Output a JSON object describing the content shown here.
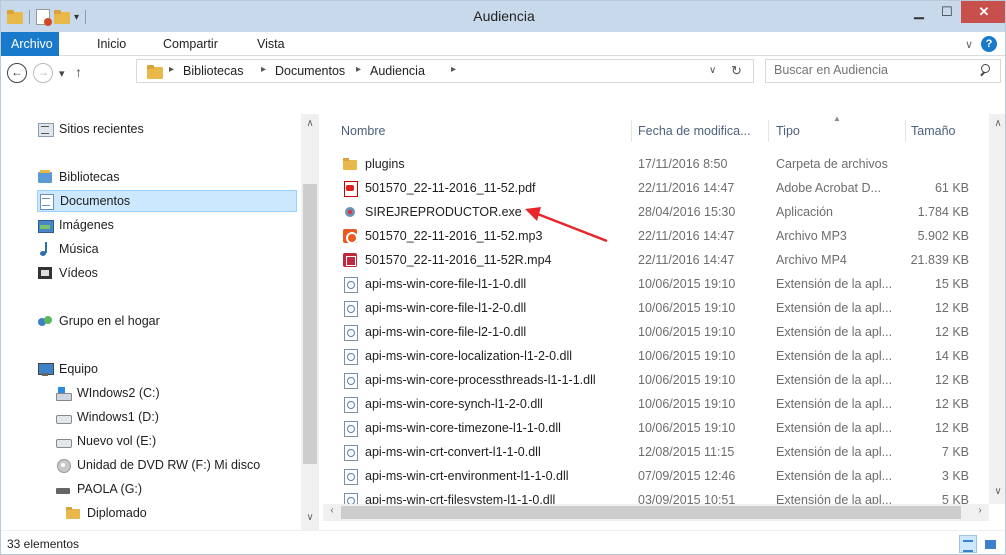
{
  "window": {
    "title": "Audiencia"
  },
  "ribbon": {
    "tabs": [
      {
        "label": "Archivo"
      },
      {
        "label": "Inicio"
      },
      {
        "label": "Compartir"
      },
      {
        "label": "Vista"
      }
    ]
  },
  "address": {
    "crumbs": [
      "Bibliotecas",
      "Documentos",
      "Audiencia"
    ]
  },
  "search": {
    "placeholder": "Buscar en Audiencia"
  },
  "nav": {
    "items": [
      {
        "label": "Sitios recientes",
        "icon": "recent-places-icon"
      },
      {
        "label": "Bibliotecas",
        "icon": "libraries-icon"
      },
      {
        "label": "Documentos",
        "icon": "documents-icon",
        "selected": true
      },
      {
        "label": "Imágenes",
        "icon": "pictures-icon"
      },
      {
        "label": "Música",
        "icon": "music-icon"
      },
      {
        "label": "Vídeos",
        "icon": "videos-icon"
      },
      {
        "label": "Grupo en el hogar",
        "icon": "homegroup-icon"
      },
      {
        "label": "Equipo",
        "icon": "computer-icon"
      },
      {
        "label": "WIndows2 (C:)",
        "icon": "windows-drive-icon"
      },
      {
        "label": "Windows1 (D:)",
        "icon": "drive-icon"
      },
      {
        "label": "Nuevo vol (E:)",
        "icon": "drive-icon"
      },
      {
        "label": "Unidad de DVD RW (F:) Mi disco",
        "icon": "dvd-drive-icon"
      },
      {
        "label": "PAOLA (G:)",
        "icon": "usb-drive-icon"
      },
      {
        "label": "Diplomado",
        "icon": "folder-icon"
      }
    ]
  },
  "columns": {
    "name": "Nombre",
    "date": "Fecha de modifica...",
    "type": "Tipo",
    "size": "Tamaño"
  },
  "files": [
    {
      "name": "plugins",
      "date": "17/11/2016 8:50",
      "type": "Carpeta de archivos",
      "size": "",
      "icon": "folder-icon"
    },
    {
      "name": "501570_22-11-2016_11-52.pdf",
      "date": "22/11/2016 14:47",
      "type": "Adobe Acrobat D...",
      "size": "61 KB",
      "icon": "pdf-icon"
    },
    {
      "name": "SIREJREPRODUCTOR.exe",
      "date": "28/04/2016 15:30",
      "type": "Aplicación",
      "size": "1.784 KB",
      "icon": "exe-icon"
    },
    {
      "name": "501570_22-11-2016_11-52.mp3",
      "date": "22/11/2016 14:47",
      "type": "Archivo MP3",
      "size": "5.902 KB",
      "icon": "mp3-icon"
    },
    {
      "name": "501570_22-11-2016_11-52R.mp4",
      "date": "22/11/2016 14:47",
      "type": "Archivo MP4",
      "size": "21.839 KB",
      "icon": "mp4-icon"
    },
    {
      "name": "api-ms-win-core-file-l1-1-0.dll",
      "date": "10/06/2015 19:10",
      "type": "Extensión de la apl...",
      "size": "15 KB",
      "icon": "dll-icon"
    },
    {
      "name": "api-ms-win-core-file-l1-2-0.dll",
      "date": "10/06/2015 19:10",
      "type": "Extensión de la apl...",
      "size": "12 KB",
      "icon": "dll-icon"
    },
    {
      "name": "api-ms-win-core-file-l2-1-0.dll",
      "date": "10/06/2015 19:10",
      "type": "Extensión de la apl...",
      "size": "12 KB",
      "icon": "dll-icon"
    },
    {
      "name": "api-ms-win-core-localization-l1-2-0.dll",
      "date": "10/06/2015 19:10",
      "type": "Extensión de la apl...",
      "size": "14 KB",
      "icon": "dll-icon"
    },
    {
      "name": "api-ms-win-core-processthreads-l1-1-1.dll",
      "date": "10/06/2015 19:10",
      "type": "Extensión de la apl...",
      "size": "12 KB",
      "icon": "dll-icon"
    },
    {
      "name": "api-ms-win-core-synch-l1-2-0.dll",
      "date": "10/06/2015 19:10",
      "type": "Extensión de la apl...",
      "size": "12 KB",
      "icon": "dll-icon"
    },
    {
      "name": "api-ms-win-core-timezone-l1-1-0.dll",
      "date": "10/06/2015 19:10",
      "type": "Extensión de la apl...",
      "size": "12 KB",
      "icon": "dll-icon"
    },
    {
      "name": "api-ms-win-crt-convert-l1-1-0.dll",
      "date": "12/08/2015 11:15",
      "type": "Extensión de la apl...",
      "size": "7 KB",
      "icon": "dll-icon"
    },
    {
      "name": "api-ms-win-crt-environment-l1-1-0.dll",
      "date": "07/09/2015 12:46",
      "type": "Extensión de la apl...",
      "size": "3 KB",
      "icon": "dll-icon"
    },
    {
      "name": "api-ms-win-crt-filesystem-l1-1-0.dll",
      "date": "03/09/2015 10:51",
      "type": "Extensión de la apl...",
      "size": "5 KB",
      "icon": "dll-icon"
    }
  ],
  "status": {
    "count": "33 elementos"
  },
  "colors": {
    "accent": "#1979ca",
    "close": "#c7504c",
    "annotation": "#e8262a"
  }
}
